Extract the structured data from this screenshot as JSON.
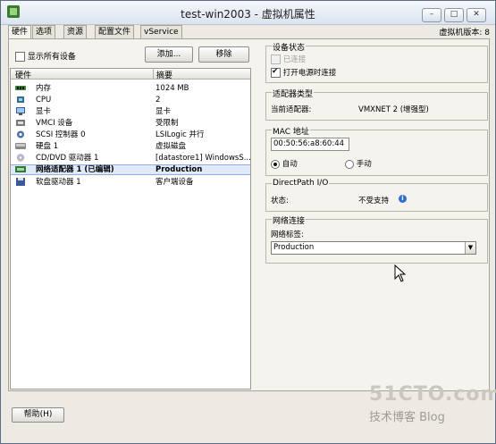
{
  "window": {
    "title": "test-win2003 - 虚拟机属性",
    "version": "虚拟机版本: 8"
  },
  "title_buttons": {
    "minimize": "–",
    "maximize": "□",
    "close": "✕"
  },
  "tabs": [
    {
      "label": "硬件",
      "active": true
    },
    {
      "label": "选项",
      "active": false
    },
    {
      "label": "资源",
      "active": false
    },
    {
      "label": "配置文件",
      "active": false
    },
    {
      "label": "vService",
      "active": false
    }
  ],
  "hardware": {
    "show_all_label": "显示所有设备",
    "add_button": "添加...",
    "remove_button": "移除",
    "col_hardware": "硬件",
    "col_summary": "摘要",
    "rows": [
      {
        "name": "内存",
        "summary": "1024 MB",
        "icon": "memory-icon",
        "selected": false
      },
      {
        "name": "CPU",
        "summary": "2",
        "icon": "cpu-icon",
        "selected": false
      },
      {
        "name": "显卡",
        "summary": "显卡",
        "icon": "display-icon",
        "selected": false
      },
      {
        "name": "VMCI 设备",
        "summary": "受限制",
        "icon": "vmci-icon",
        "selected": false
      },
      {
        "name": "SCSI 控制器 0",
        "summary": "LSILogic 并行",
        "icon": "scsi-icon",
        "selected": false
      },
      {
        "name": "硬盘 1",
        "summary": "虚拟磁盘",
        "icon": "harddisk-icon",
        "selected": false
      },
      {
        "name": "CD/DVD 驱动器 1",
        "summary": "[datastore1] WindowsS...",
        "icon": "cdrom-icon",
        "selected": false
      },
      {
        "name": "网络适配器 1 (已编辑)",
        "summary": "Production",
        "icon": "network-adapter-icon",
        "selected": true
      },
      {
        "name": "软盘驱动器 1",
        "summary": "客户端设备",
        "icon": "floppy-icon",
        "selected": false
      }
    ]
  },
  "device_status": {
    "title": "设备状态",
    "connected_label": "已连接",
    "connect_on_power_label": "打开电源时连接"
  },
  "adapter_type": {
    "title": "适配器类型",
    "current_label": "当前适配器:",
    "current_value": "VMXNET 2 (增强型)"
  },
  "mac": {
    "title": "MAC 地址",
    "value": "00:50:56:a8:60:44",
    "auto_label": "自动",
    "manual_label": "手动"
  },
  "directpath": {
    "title": "DirectPath I/O",
    "status_label": "状态:",
    "status_value": "不受支持",
    "info_icon": "i"
  },
  "network": {
    "title": "网络连接",
    "label": "网络标签:",
    "value": "Production",
    "arrow": "▼"
  },
  "help_button": "帮助(H)",
  "watermark": {
    "line1": "51CTO.com",
    "line2": "技术博客 Blog"
  }
}
